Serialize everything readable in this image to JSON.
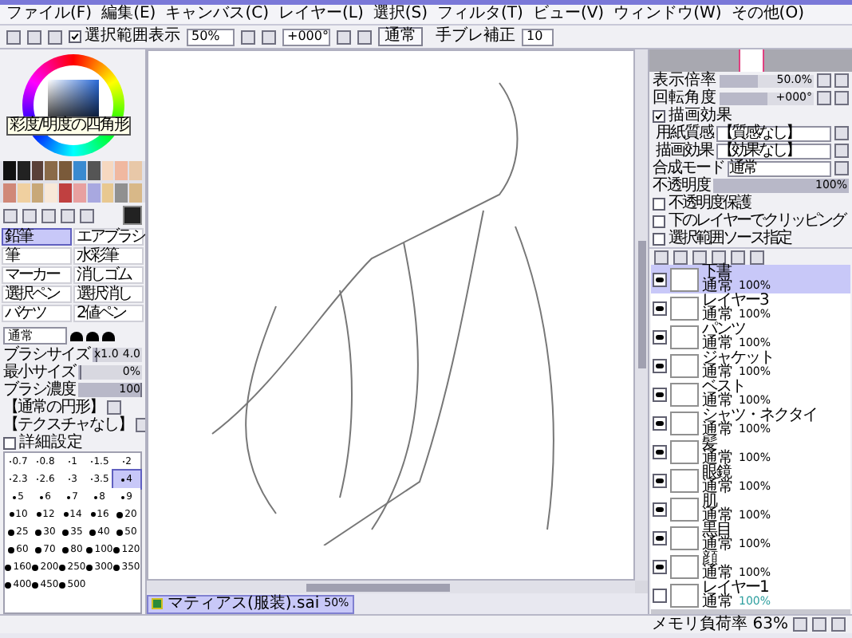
{
  "menu": [
    "ファイル(F)",
    "編集(E)",
    "キャンバス(C)",
    "レイヤー(L)",
    "選択(S)",
    "フィルタ(T)",
    "ビュー(V)",
    "ウィンドウ(W)",
    "その他(O)"
  ],
  "toolbar": {
    "show_selection": {
      "label": "選択範囲表示",
      "checked": true
    },
    "zoom": "50%",
    "angle": "+000°",
    "blend_button": "通常",
    "stabilizer": {
      "label": "手ブレ補正",
      "value": "10"
    }
  },
  "color_tooltip": "彩度/明度の四角形",
  "swatches": [
    {
      "color": "#111111"
    },
    {
      "color": "#222222"
    },
    {
      "color": "#5a4038"
    },
    {
      "color": "#8a6a48"
    },
    {
      "color": "#7a5a3a"
    },
    {
      "color": "#3a8ad0"
    },
    {
      "color": "#555555"
    },
    {
      "color": "#f6d8c0"
    },
    {
      "color": "#f0b8a0"
    },
    {
      "color": "#e8c8a8"
    },
    {
      "color": "#d08878"
    },
    {
      "color": "#f0d0a0"
    },
    {
      "color": "#c8a878"
    },
    {
      "color": "#f8e8d8"
    },
    {
      "color": "#c04040"
    },
    {
      "color": "#e8a0a0"
    },
    {
      "color": "#a8a8e0"
    },
    {
      "color": "#e8c890"
    },
    {
      "color": "#909090"
    },
    {
      "color": "#d8b888"
    }
  ],
  "tools": [
    {
      "label": "鉛筆",
      "selected": true
    },
    {
      "label": "エアブラシ",
      "selected": false
    },
    {
      "label": "筆",
      "selected": false
    },
    {
      "label": "水彩筆",
      "selected": false
    },
    {
      "label": "マーカー",
      "selected": false
    },
    {
      "label": "消しゴム",
      "selected": false
    },
    {
      "label": "選択ペン",
      "selected": false
    },
    {
      "label": "選択消し",
      "selected": false
    },
    {
      "label": "バケツ",
      "selected": false
    },
    {
      "label": "2値ペン",
      "selected": false
    }
  ],
  "brush": {
    "mode": "通常",
    "size": {
      "label": "ブラシサイズ",
      "multiplier": "x1.0",
      "value": "4.0",
      "level": 0.1
    },
    "min_size": {
      "label": "最小サイズ",
      "value": "0%",
      "level": 0
    },
    "density": {
      "label": "ブラシ濃度",
      "value": "100",
      "level": 1
    },
    "shape": "【通常の円形】",
    "texture": "【テクスチャなし】",
    "advanced": {
      "label": "詳細設定",
      "checked": false
    }
  },
  "sizes": [
    {
      "label": "0.7",
      "selected": false
    },
    {
      "label": "0.8",
      "selected": false
    },
    {
      "label": "1",
      "selected": false
    },
    {
      "label": "1.5",
      "selected": false
    },
    {
      "label": "2",
      "selected": false
    },
    {
      "label": "2.3",
      "selected": false
    },
    {
      "label": "2.6",
      "selected": false
    },
    {
      "label": "3",
      "selected": false
    },
    {
      "label": "3.5",
      "selected": false
    },
    {
      "label": "4",
      "selected": true
    },
    {
      "label": "5",
      "selected": false
    },
    {
      "label": "6",
      "selected": false
    },
    {
      "label": "7",
      "selected": false
    },
    {
      "label": "8",
      "selected": false
    },
    {
      "label": "9",
      "selected": false
    },
    {
      "label": "10",
      "selected": false
    },
    {
      "label": "12",
      "selected": false
    },
    {
      "label": "14",
      "selected": false
    },
    {
      "label": "16",
      "selected": false
    },
    {
      "label": "20",
      "selected": false
    },
    {
      "label": "25",
      "selected": false
    },
    {
      "label": "30",
      "selected": false
    },
    {
      "label": "35",
      "selected": false
    },
    {
      "label": "40",
      "selected": false
    },
    {
      "label": "50",
      "selected": false
    },
    {
      "label": "60",
      "selected": false
    },
    {
      "label": "70",
      "selected": false
    },
    {
      "label": "80",
      "selected": false
    },
    {
      "label": "100",
      "selected": false
    },
    {
      "label": "120",
      "selected": false
    },
    {
      "label": "160",
      "selected": false
    },
    {
      "label": "200",
      "selected": false
    },
    {
      "label": "250",
      "selected": false
    },
    {
      "label": "300",
      "selected": false
    },
    {
      "label": "350",
      "selected": false
    },
    {
      "label": "400",
      "selected": false
    },
    {
      "label": "450",
      "selected": false
    },
    {
      "label": "500",
      "selected": false
    }
  ],
  "navigator": {
    "zoom": {
      "label": "表示倍率",
      "value": "50.0%",
      "level": 0.4
    },
    "angle": {
      "label": "回転角度",
      "value": "+000°",
      "level": 0.5
    }
  },
  "effects": {
    "header": {
      "label": "描画効果",
      "checked": true
    },
    "paper": {
      "label": "用紙質感",
      "value": "【質感なし】"
    },
    "effect": {
      "label": "描画効果",
      "value": "【効果なし】"
    }
  },
  "layer_props": {
    "mode": {
      "label": "合成モード",
      "value": "通常"
    },
    "opacity": {
      "label": "不透明度",
      "value": "100%",
      "level": 1
    },
    "options": [
      {
        "label": "不透明度保護",
        "checked": false
      },
      {
        "label": "下のレイヤーでクリッピング",
        "checked": false
      },
      {
        "label": "選択範囲ソース指定",
        "checked": false
      }
    ]
  },
  "layers": [
    {
      "name": "下書",
      "mode": "通常",
      "opacity": "100%",
      "visible": true,
      "selected": true
    },
    {
      "name": "レイヤー3",
      "mode": "通常",
      "opacity": "100%",
      "visible": true,
      "selected": false
    },
    {
      "name": "パンツ",
      "mode": "通常",
      "opacity": "100%",
      "visible": true,
      "selected": false
    },
    {
      "name": "ジャケット",
      "mode": "通常",
      "opacity": "100%",
      "visible": true,
      "selected": false
    },
    {
      "name": "ベスト",
      "mode": "通常",
      "opacity": "100%",
      "visible": true,
      "selected": false
    },
    {
      "name": "シャツ・ネクタイ",
      "mode": "通常",
      "opacity": "100%",
      "visible": true,
      "selected": false
    },
    {
      "name": "髪",
      "mode": "通常",
      "opacity": "100%",
      "visible": true,
      "selected": false
    },
    {
      "name": "眼鏡",
      "mode": "通常",
      "opacity": "100%",
      "visible": true,
      "selected": false
    },
    {
      "name": "肌",
      "mode": "通常",
      "opacity": "100%",
      "visible": true,
      "selected": false
    },
    {
      "name": "黒目",
      "mode": "通常",
      "opacity": "100%",
      "visible": true,
      "selected": false
    },
    {
      "name": "顔",
      "mode": "通常",
      "opacity": "100%",
      "visible": true,
      "selected": false
    },
    {
      "name": "レイヤー1",
      "mode": "通常",
      "opacity": "100%",
      "visible": false,
      "selected": false
    }
  ],
  "document_tab": {
    "name": "マティアス(服装).sai",
    "zoom": "50%"
  },
  "status": "メモリ負荷率 63%"
}
